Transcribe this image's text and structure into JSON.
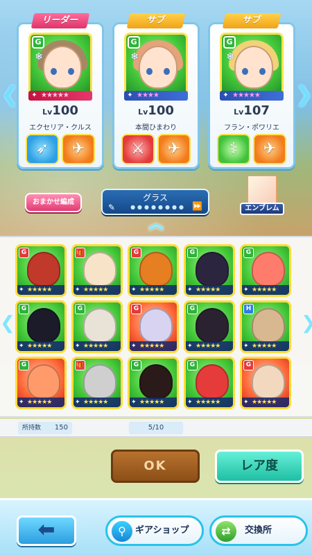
{
  "party": {
    "nav_left": "❮",
    "nav_right": "❯",
    "cards": [
      {
        "role": "リーダー",
        "element_badge": "G",
        "weapon_type": "𝄞",
        "stars": "★★★★★",
        "level_prefix": "Lv",
        "level": "100",
        "name": "エクセリア・クルス",
        "gear": [
          "blue",
          "orange"
        ]
      },
      {
        "role": "サブ",
        "element_badge": "G",
        "weapon_type": "𝄞",
        "stars": "★★★★",
        "level_prefix": "Lv",
        "level": "100",
        "name": "本間ひまわり",
        "gear": [
          "red",
          "orange"
        ]
      },
      {
        "role": "サブ",
        "element_badge": "G",
        "weapon_type": "𝄞",
        "stars": "★★★★★",
        "level_prefix": "Lv",
        "level": "107",
        "name": "フラン・ポワリエ",
        "gear": [
          "green",
          "orange"
        ]
      }
    ],
    "auto_button": "おまかせ編成",
    "filter": {
      "label": "グラス",
      "dots": "●●●●●●●●"
    },
    "emblem_label": "エンブレム",
    "collapse_icon": "︽"
  },
  "inventory": {
    "units": [
      {
        "element": "grass",
        "badge": "G",
        "badge_class": "r",
        "stars": "★★★★★",
        "color": "#c0392b"
      },
      {
        "element": "grass",
        "badge": "🎁",
        "badge_class": "gift",
        "stars": "★★★★★",
        "color": "#f6e3c8"
      },
      {
        "element": "grass",
        "badge": "G",
        "badge_class": "r",
        "stars": "★★★★★",
        "color": "#e67e22"
      },
      {
        "element": "grass",
        "badge": "G",
        "badge_class": "g",
        "stars": "★★★★★",
        "color": "#2c2540"
      },
      {
        "element": "grass",
        "badge": "G",
        "badge_class": "g",
        "stars": "★★★★★",
        "color": "#ff7b6b"
      },
      {
        "element": "grass",
        "badge": "G",
        "badge_class": "g",
        "stars": "★★★★★",
        "color": "#1b1b2a"
      },
      {
        "element": "grass",
        "badge": "G",
        "badge_class": "g",
        "stars": "★★★★★",
        "color": "#e9e2d6"
      },
      {
        "element": "fire",
        "badge": "G",
        "badge_class": "r",
        "stars": "★★★★★",
        "color": "#d9d3f2"
      },
      {
        "element": "grass",
        "badge": "G",
        "badge_class": "g",
        "stars": "★★★★★",
        "color": "#2a2230"
      },
      {
        "element": "grass",
        "badge": "H",
        "badge_class": "h",
        "stars": "★★★★★",
        "color": "#d8b890"
      },
      {
        "element": "fire",
        "badge": "G",
        "badge_class": "g",
        "stars": "★★★★★",
        "color": "#ff9a6b"
      },
      {
        "element": "grass",
        "badge": "🎁",
        "badge_class": "gift",
        "stars": "★★★★★",
        "color": "#cfcfcf"
      },
      {
        "element": "grass",
        "badge": "G",
        "badge_class": "g",
        "stars": "★★★★★",
        "color": "#2a1a1a"
      },
      {
        "element": "grass",
        "badge": "G",
        "badge_class": "g",
        "stars": "★★★★★",
        "color": "#e63b3b"
      },
      {
        "element": "fire",
        "badge": "G",
        "badge_class": "r",
        "stars": "★★★★★",
        "color": "#f3d8c0"
      }
    ],
    "count_label": "所持数",
    "count_value": "150",
    "page": "5/10",
    "nav_left": "❮",
    "nav_right": "❯"
  },
  "actions": {
    "ok": "OK",
    "rarity": "レア度"
  },
  "footer": {
    "back_icon": "⬅",
    "gear_shop": "ギアショップ",
    "exchange": "交換所"
  }
}
